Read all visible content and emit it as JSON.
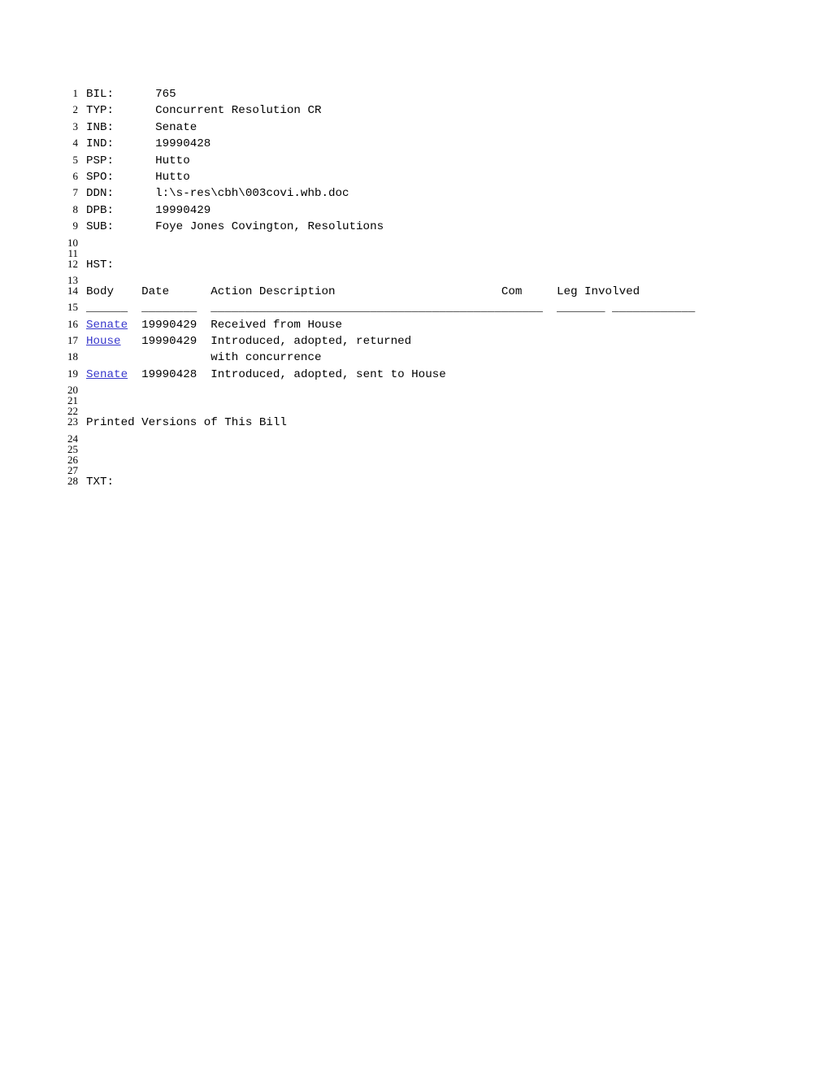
{
  "document": {
    "type": "legislative-bill-record",
    "link_color": "#3838cc",
    "text_color": "#000000",
    "background_color": "#ffffff"
  },
  "fields": {
    "bil_label": "BIL:",
    "bil_value": "765",
    "typ_label": "TYP:",
    "typ_value": "Concurrent Resolution CR",
    "inb_label": "INB:",
    "inb_value": "Senate",
    "ind_label": "IND:",
    "ind_value": "19990428",
    "psp_label": "PSP:",
    "psp_value": "Hutto",
    "spo_label": "SPO:",
    "spo_value": "Hutto",
    "ddn_label": "DDN:",
    "ddn_value": "l:\\s-res\\cbh\\003covi.whb.doc",
    "dpb_label": "DPB:",
    "dpb_value": "19990429",
    "sub_label": "SUB:",
    "sub_value": "Foye Jones Covington, Resolutions",
    "hst_label": "HST:",
    "txt_label": "TXT:"
  },
  "history": {
    "headers": {
      "body": "Body",
      "date": "Date",
      "action": "Action Description",
      "com": "Com",
      "leg": "Leg Involved"
    },
    "separators": {
      "body": "______",
      "date": "________",
      "action": "________________________________________________",
      "com": "_______",
      "leg": "____________"
    },
    "rows": [
      {
        "body": "Senate",
        "body_is_link": true,
        "date": "19990429",
        "action": "Received from House",
        "com": "",
        "leg": ""
      },
      {
        "body": "House",
        "body_is_link": true,
        "date": "19990429",
        "action": "Introduced, adopted, returned",
        "com": "",
        "leg": ""
      },
      {
        "body": "",
        "body_is_link": false,
        "date": "",
        "action": "with concurrence",
        "com": "",
        "leg": ""
      },
      {
        "body": "Senate",
        "body_is_link": true,
        "date": "19990428",
        "action": "Introduced, adopted, sent to House",
        "com": "",
        "leg": ""
      }
    ]
  },
  "sections": {
    "printed_versions_heading": "Printed Versions of This Bill"
  },
  "lines": [
    {
      "n": "1",
      "kind": "field",
      "text": "BIL:      765"
    },
    {
      "n": "2",
      "kind": "field",
      "text": "TYP:      Concurrent Resolution CR"
    },
    {
      "n": "3",
      "kind": "field",
      "text": "INB:      Senate"
    },
    {
      "n": "4",
      "kind": "field",
      "text": "IND:      19990428"
    },
    {
      "n": "5",
      "kind": "field",
      "text": "PSP:      Hutto"
    },
    {
      "n": "6",
      "kind": "field",
      "text": "SPO:      Hutto"
    },
    {
      "n": "7",
      "kind": "field",
      "text": "DDN:      l:\\s-res\\cbh\\003covi.whb.doc"
    },
    {
      "n": "8",
      "kind": "field",
      "text": "DPB:      19990429"
    },
    {
      "n": "9",
      "kind": "field",
      "text": "SUB:      Foye Jones Covington, Resolutions"
    },
    {
      "n": "10",
      "kind": "blank",
      "text": ""
    },
    {
      "n": "11",
      "kind": "blank",
      "text": ""
    },
    {
      "n": "12",
      "kind": "field",
      "text": "HST:"
    },
    {
      "n": "13",
      "kind": "blank",
      "text": ""
    },
    {
      "n": "14",
      "kind": "tblheader",
      "text": "Body    Date      Action Description                        Com     Leg Involved"
    },
    {
      "n": "15",
      "kind": "tblsep",
      "text": "______  ________  ________________________________________________  _______ ____________"
    },
    {
      "n": "16",
      "kind": "tblrow",
      "text": "Senate  19990429  Received from House"
    },
    {
      "n": "17",
      "kind": "tblrow",
      "text": "House   19990429  Introduced, adopted, returned"
    },
    {
      "n": "18",
      "kind": "tblrow",
      "text": "                  with concurrence"
    },
    {
      "n": "19",
      "kind": "tblrow",
      "text": "Senate  19990428  Introduced, adopted, sent to House"
    },
    {
      "n": "20",
      "kind": "blank",
      "text": ""
    },
    {
      "n": "21",
      "kind": "blank",
      "text": ""
    },
    {
      "n": "22",
      "kind": "blank",
      "text": ""
    },
    {
      "n": "23",
      "kind": "heading",
      "text": "Printed Versions of This Bill"
    },
    {
      "n": "24",
      "kind": "blank",
      "text": ""
    },
    {
      "n": "25",
      "kind": "blank",
      "text": ""
    },
    {
      "n": "26",
      "kind": "blank",
      "text": ""
    },
    {
      "n": "27",
      "kind": "blank",
      "text": ""
    },
    {
      "n": "28",
      "kind": "field",
      "text": "TXT:"
    }
  ]
}
